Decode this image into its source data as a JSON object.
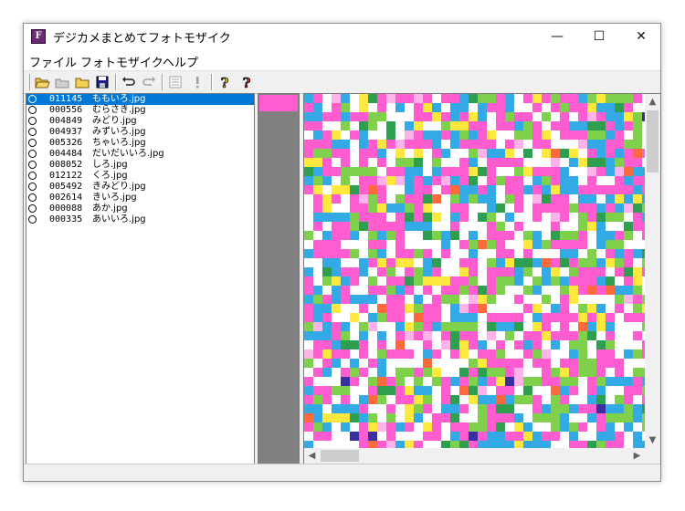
{
  "window": {
    "title": "デジカメまとめてフォトモザイク",
    "icon_letter": "F",
    "minimize": "—",
    "maximize": "☐",
    "close": "✕"
  },
  "menu": [
    "ファイル",
    "フォトモザイク",
    "ヘルプ"
  ],
  "toolbar": {
    "icons": [
      "open-folder-icon",
      "camera-folder-icon",
      "folder-icon",
      "save-icon",
      "undo-icon",
      "redo-icon",
      "list-icon",
      "exclamation-icon",
      "help-icon",
      "context-help-icon"
    ]
  },
  "files": [
    {
      "num": "011145",
      "name": "ももいろ.jpg",
      "selected": true
    },
    {
      "num": "000556",
      "name": "むらさき.jpg"
    },
    {
      "num": "004849",
      "name": "みどり.jpg"
    },
    {
      "num": "004937",
      "name": "みずいろ.jpg"
    },
    {
      "num": "005326",
      "name": "ちゃいろ.jpg"
    },
    {
      "num": "004484",
      "name": "だいだいいろ.jpg"
    },
    {
      "num": "008052",
      "name": "しろ.jpg"
    },
    {
      "num": "012122",
      "name": "くろ.jpg"
    },
    {
      "num": "005492",
      "name": "きみどり.jpg"
    },
    {
      "num": "002614",
      "name": "きいろ.jpg"
    },
    {
      "num": "000088",
      "name": "あか.jpg"
    },
    {
      "num": "000335",
      "name": "あいいろ.jpg"
    }
  ],
  "colors": {
    "selection": "#0078d7",
    "preview_swatch": "#ff5ccf",
    "mosaic_palette": [
      "#ff5ccf",
      "#ffffff",
      "#33a9e6",
      "#7fd14c",
      "#ffe83d",
      "#2e9e4f",
      "#ff6a3d",
      "#3a2fa0",
      "#ffb3ea"
    ]
  }
}
